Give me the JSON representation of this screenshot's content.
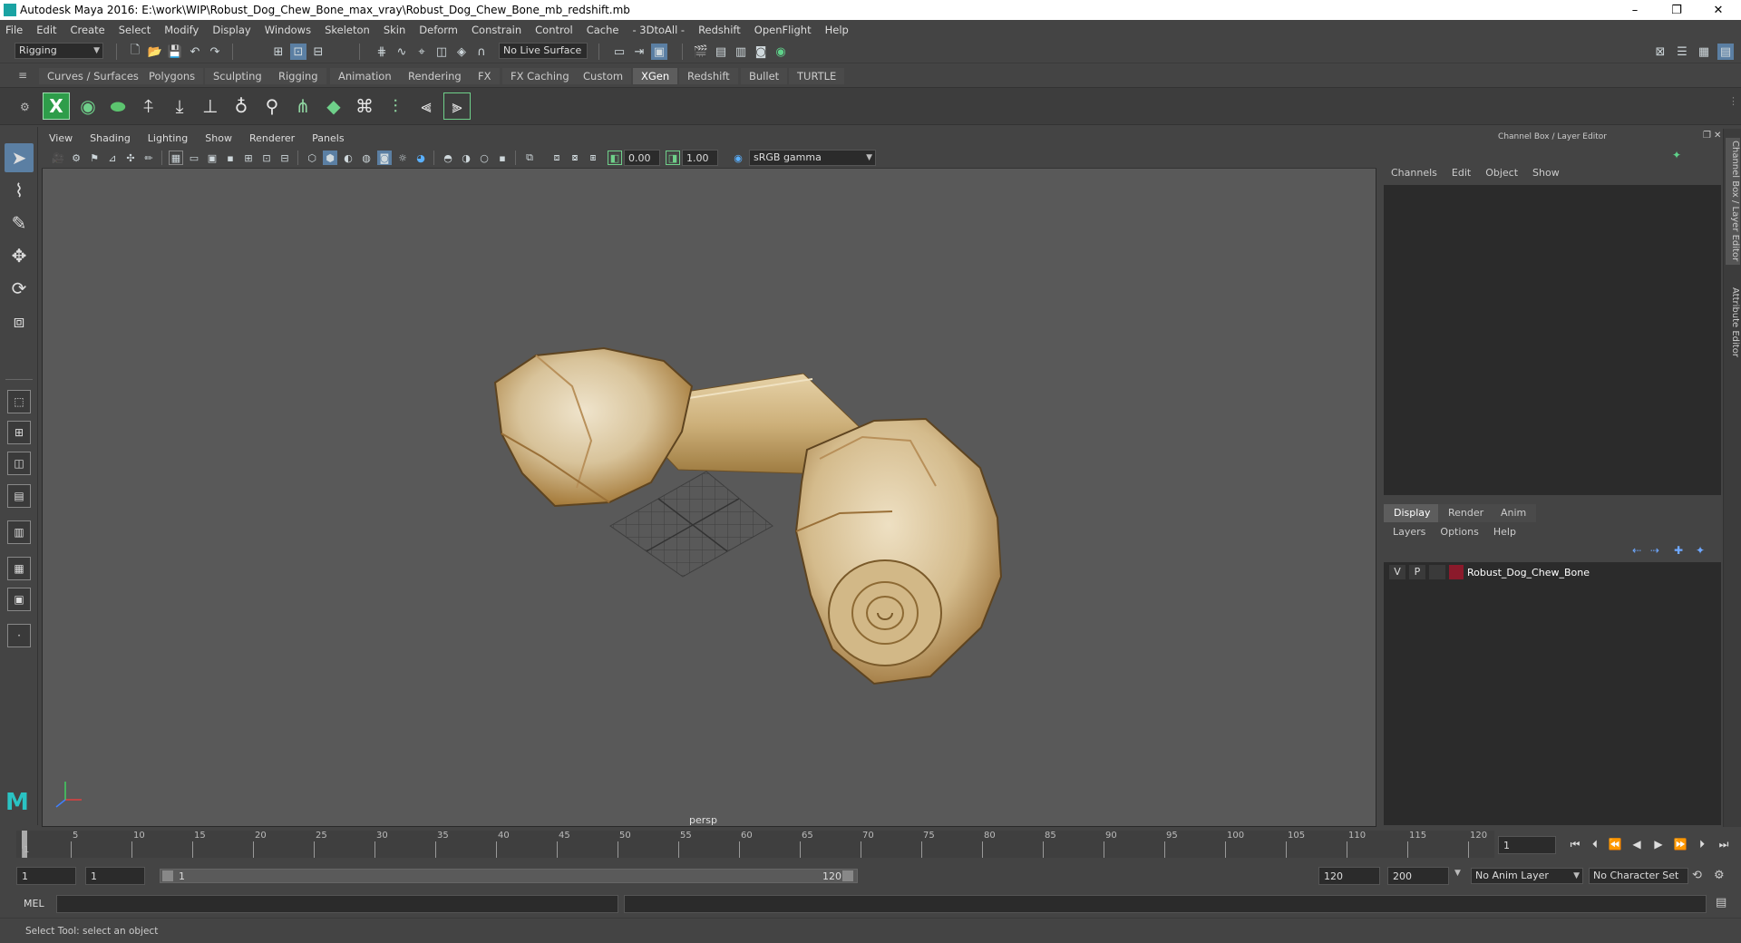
{
  "titlebar": {
    "title": "Autodesk Maya 2016: E:\\work\\WIP\\Robust_Dog_Chew_Bone_max_vray\\Robust_Dog_Chew_Bone_mb_redshift.mb",
    "minimize": "–",
    "restore": "❐",
    "close": "✕"
  },
  "menubar": [
    "File",
    "Edit",
    "Create",
    "Select",
    "Modify",
    "Display",
    "Windows",
    "Skeleton",
    "Skin",
    "Deform",
    "Constrain",
    "Control",
    "Cache",
    "- 3DtoAll -",
    "Redshift",
    "OpenFlight",
    "Help"
  ],
  "statusline": {
    "menuset": "Rigging",
    "live_surface": "No Live Surface"
  },
  "shelf_tabs": [
    "Curves / Surfaces",
    "Polygons",
    "Sculpting",
    "Rigging",
    "Animation",
    "Rendering",
    "FX",
    "FX Caching",
    "Custom",
    "XGen",
    "Redshift",
    "Bullet",
    "TURTLE"
  ],
  "active_shelf_tab": "XGen",
  "viewport": {
    "menu": [
      "View",
      "Shading",
      "Lighting",
      "Show",
      "Renderer",
      "Panels"
    ],
    "exposure": "0.00",
    "gamma": "1.00",
    "color_space": "sRGB gamma",
    "camera_label": "persp"
  },
  "channel_box": {
    "title": "Channel Box / Layer Editor",
    "menu": [
      "Channels",
      "Edit",
      "Object",
      "Show"
    ]
  },
  "layer_editor": {
    "tabs": [
      "Display",
      "Render",
      "Anim"
    ],
    "active_tab": "Display",
    "menu": [
      "Layers",
      "Options",
      "Help"
    ],
    "layers": [
      {
        "v": "V",
        "p": "P",
        "name": "Robust_Dog_Chew_Bone",
        "color": "#8b1a2b"
      }
    ]
  },
  "side_tabs": [
    "Channel Box / Layer Editor",
    "Attribute Editor"
  ],
  "timeslider": {
    "ticks": [
      "1",
      "5",
      "10",
      "15",
      "20",
      "25",
      "30",
      "35",
      "40",
      "45",
      "50",
      "55",
      "60",
      "65",
      "70",
      "75",
      "80",
      "85",
      "90",
      "95",
      "100",
      "105",
      "110",
      "115",
      "120"
    ],
    "current_frame": "1"
  },
  "range": {
    "start": "1",
    "playback_start": "1",
    "slider_start": "1",
    "slider_end": "120",
    "playback_end": "120",
    "end": "200",
    "anim_layer": "No Anim Layer",
    "character_set": "No Character Set"
  },
  "cmdline": {
    "label": "MEL"
  },
  "helpline": {
    "text": "Select Tool: select an object"
  },
  "colors": {
    "accent": "#5b7fa3",
    "xgen_green": "#2e9d4a",
    "layer_color": "#8b1a2b"
  }
}
